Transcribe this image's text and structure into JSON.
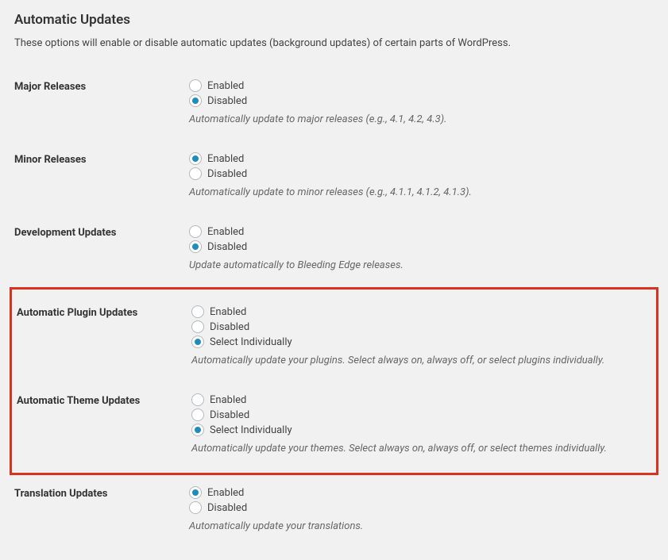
{
  "header": {
    "title": "Automatic Updates",
    "description": "These options will enable or disable automatic updates (background updates) of certain parts of WordPress."
  },
  "options": {
    "enabled": "Enabled",
    "disabled": "Disabled",
    "select_individually": "Select Individually"
  },
  "sections": {
    "major": {
      "label": "Major Releases",
      "selected": "disabled",
      "description": "Automatically update to major releases (e.g., 4.1, 4.2, 4.3)."
    },
    "minor": {
      "label": "Minor Releases",
      "selected": "enabled",
      "description": "Automatically update to minor releases (e.g., 4.1.1, 4.1.2, 4.1.3)."
    },
    "development": {
      "label": "Development Updates",
      "selected": "disabled",
      "description": "Update automatically to Bleeding Edge releases."
    },
    "plugin": {
      "label": "Automatic Plugin Updates",
      "selected": "select_individually",
      "description": "Automatically update your plugins. Select always on, always off, or select plugins individually."
    },
    "theme": {
      "label": "Automatic Theme Updates",
      "selected": "select_individually",
      "description": "Automatically update your themes. Select always on, always off, or select themes individually."
    },
    "translation": {
      "label": "Translation Updates",
      "selected": "enabled",
      "description": "Automatically update your translations."
    }
  }
}
